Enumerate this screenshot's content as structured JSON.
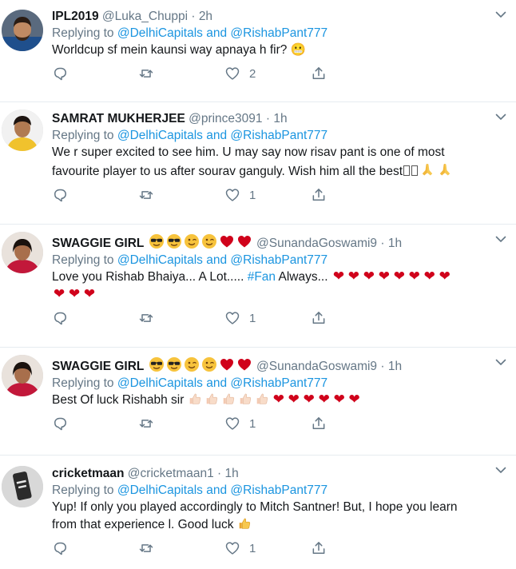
{
  "reply_prefix": "Replying to",
  "tweets": [
    {
      "name": "IPL2019",
      "handle": "@Luka_Chuppi",
      "time": "2h",
      "reply_to": "@DelhiCapitals and @RishabPant777",
      "text": "Worldcup sf mein kaunsi way apnaya h fir? 😬",
      "likes": "2"
    },
    {
      "name": "SAMRAT MUKHERJEE",
      "handle": "@prince3091",
      "time": "1h",
      "reply_to": "@DelhiCapitals and @RishabPant777",
      "text_line1": "We r super excited to see him. U may say now risav pant is one of most",
      "text_line2": "favourite player to us after sourav ganguly. Wish him all the best",
      "text_line2_emoji": "🙏🙏",
      "likes": "1"
    },
    {
      "name": "SWAGGIE GIRL",
      "name_emoji": "😎😎😉😉❤❤",
      "handle": "@SunandaGoswami9",
      "time": "1h",
      "reply_to": "@DelhiCapitals and @RishabPant777",
      "text_before": "Love you Rishab Bhaiya... A Lot.....",
      "hashtag": "#Fan",
      "text_after": "Always...",
      "hearts_line1": "❤ ❤ ❤ ❤ ❤ ❤ ❤ ❤",
      "hearts_line2": "❤ ❤ ❤",
      "likes": "1"
    },
    {
      "name": "SWAGGIE GIRL",
      "name_emoji": "😎😎😉😉❤❤",
      "handle": "@SunandaGoswami9",
      "time": "1h",
      "reply_to": "@DelhiCapitals and @RishabPant777",
      "text": "Best Of luck Rishabh sir",
      "thumbs": "👍🏻👍🏻👍🏻👍🏻👍🏻",
      "hearts": "❤ ❤ ❤ ❤ ❤ ❤",
      "likes": "1"
    },
    {
      "name": "cricketmaan",
      "handle": "@cricketmaan1",
      "time": "1h",
      "reply_to": "@DelhiCapitals and @RishabPant777",
      "text_line1": "Yup! If only you played accordingly to Mitch Santner! But, I hope you learn",
      "text_line2": "from that experience l. Good luck",
      "text_line2_emoji": "👍",
      "likes": "1"
    }
  ],
  "colors": {
    "link": "#1b95e0",
    "muted": "#657786",
    "text": "#14171a",
    "heart": "#d0021b",
    "divider": "#e6ecf0"
  },
  "icons": [
    "reply-icon",
    "retweet-icon",
    "like-icon",
    "share-icon",
    "chevron-down-icon"
  ]
}
